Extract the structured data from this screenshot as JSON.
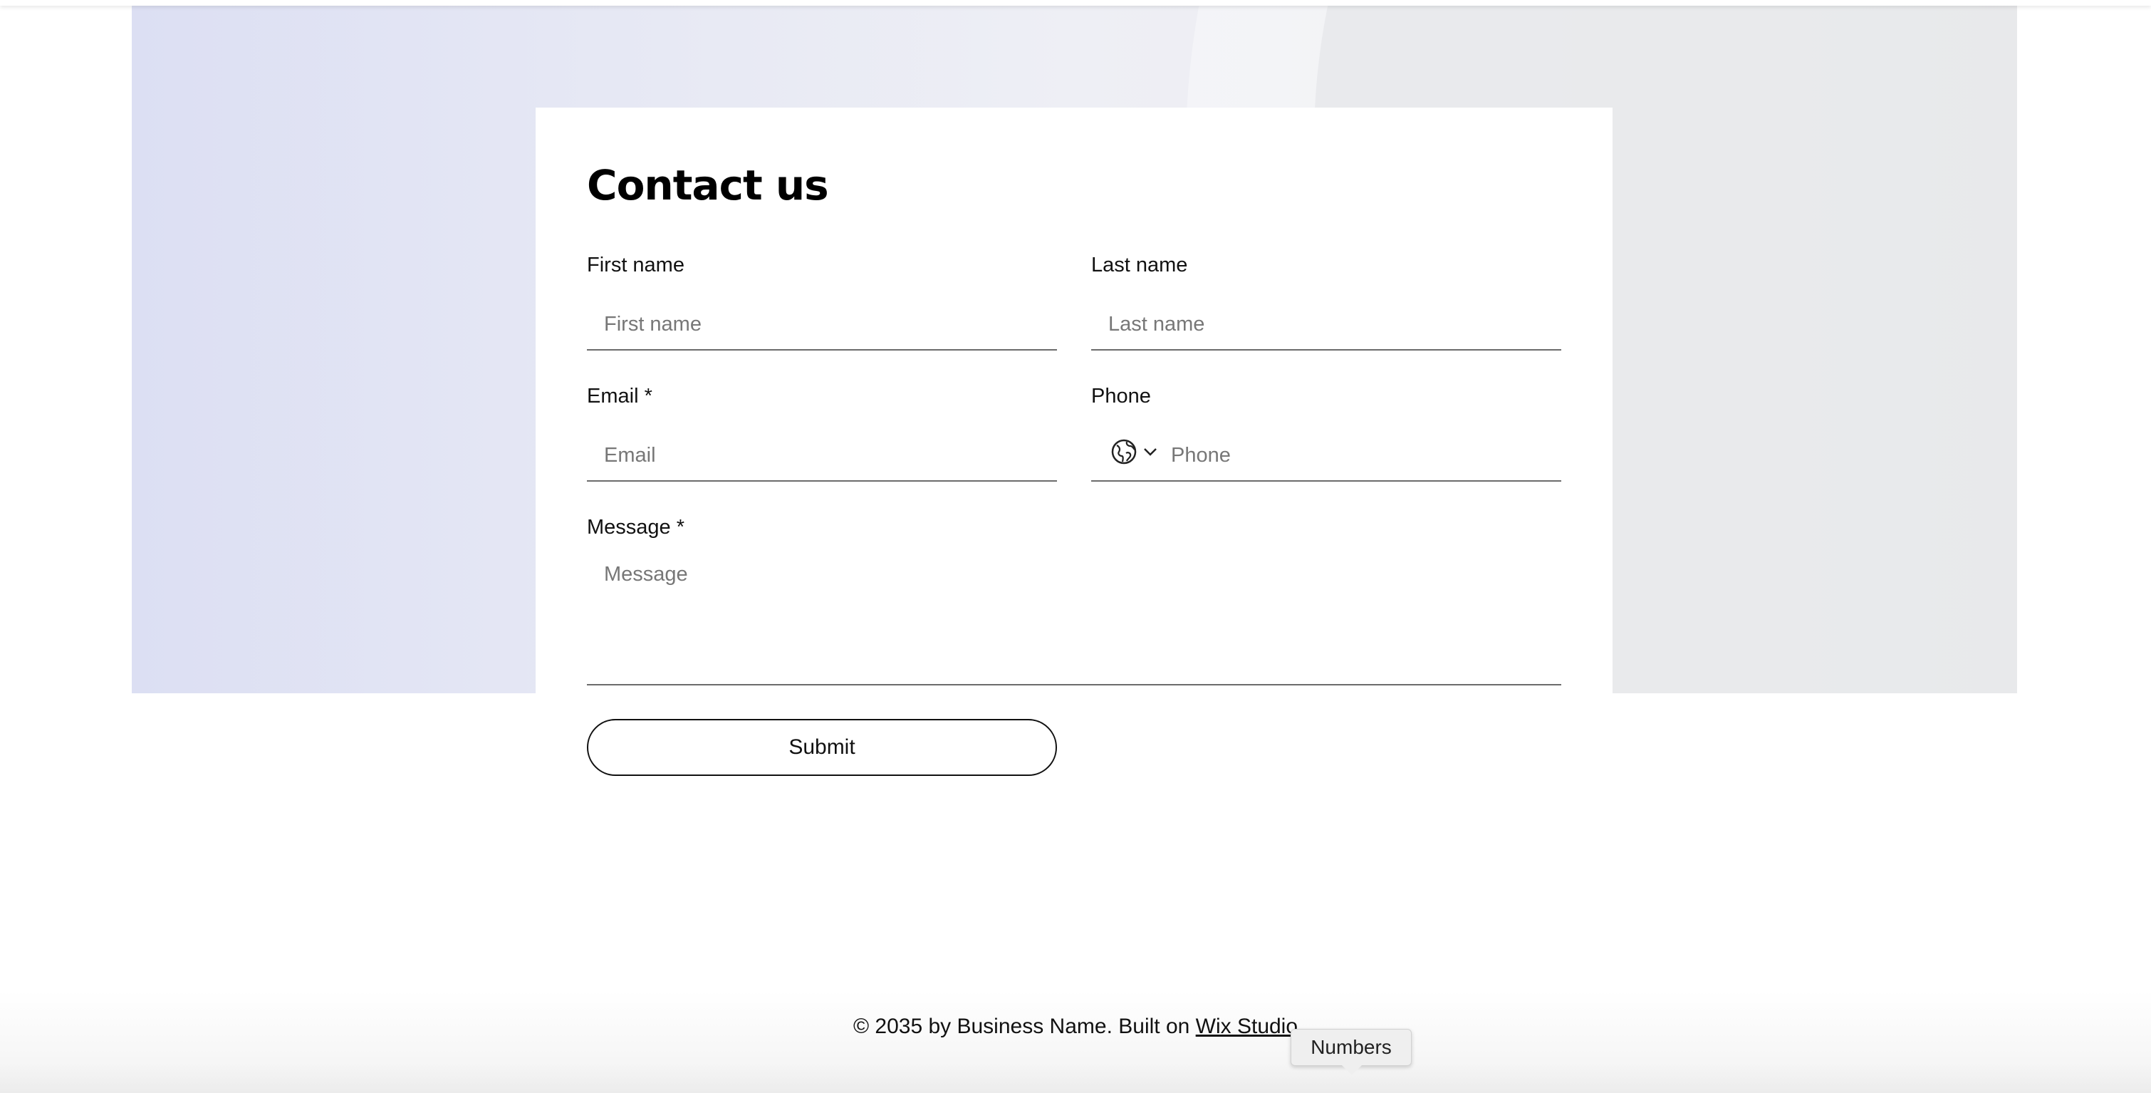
{
  "form": {
    "title": "Contact us",
    "first_name": {
      "label": "First name",
      "placeholder": "First name"
    },
    "last_name": {
      "label": "Last name",
      "placeholder": "Last name"
    },
    "email": {
      "label": "Email *",
      "placeholder": "Email"
    },
    "phone": {
      "label": "Phone",
      "placeholder": "Phone",
      "prefix_icon": "globe-icon"
    },
    "message": {
      "label": "Message *",
      "placeholder": "Message"
    },
    "submit_label": "Submit"
  },
  "footer": {
    "text": "© 2035 by Business Name. Built on ",
    "link_label": "Wix Studio"
  },
  "tooltip": {
    "text": "Numbers"
  },
  "colors": {
    "background": "#ffffff",
    "hero_gradient_start": "#dcdff3",
    "hero_gradient_end": "#e8e9e8",
    "text": "#000000",
    "input_underline": "#6b6b6b"
  }
}
